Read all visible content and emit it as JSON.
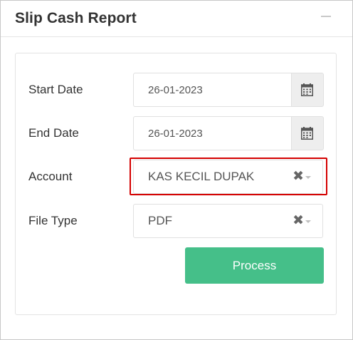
{
  "panel": {
    "title": "Slip Cash Report"
  },
  "form": {
    "start_date": {
      "label": "Start Date",
      "value": "26-01-2023"
    },
    "end_date": {
      "label": "End Date",
      "value": "26-01-2023"
    },
    "account": {
      "label": "Account",
      "value": "KAS KECIL DUPAK",
      "clear_icon": "times-icon"
    },
    "file_type": {
      "label": "File Type",
      "value": "PDF",
      "clear_icon": "times-icon"
    },
    "process_label": "Process"
  },
  "colors": {
    "accent_button": "#45bf89",
    "highlight_border": "#d40000"
  }
}
